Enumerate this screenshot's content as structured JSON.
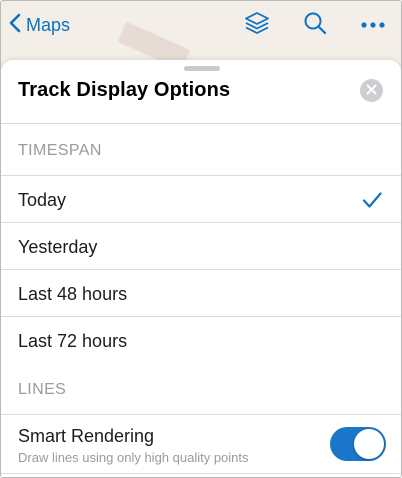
{
  "nav": {
    "back_label": "Maps",
    "icons": [
      "chevron-left-icon",
      "layers-icon",
      "search-icon",
      "more-icon"
    ],
    "accent_color": "#0b72c4"
  },
  "sheet": {
    "title": "Track Display Options",
    "close_icon": "close-icon"
  },
  "timespan": {
    "header": "TIMESPAN",
    "options": [
      {
        "label": "Today",
        "selected": true
      },
      {
        "label": "Yesterday",
        "selected": false
      },
      {
        "label": "Last 48 hours",
        "selected": false
      },
      {
        "label": "Last 72 hours",
        "selected": false
      }
    ],
    "check_icon": "checkmark-icon"
  },
  "lines": {
    "header": "LINES",
    "smart_rendering": {
      "label": "Smart Rendering",
      "description": "Draw lines using only high quality points",
      "enabled": true,
      "toggle_color": "#1a76c8"
    }
  }
}
